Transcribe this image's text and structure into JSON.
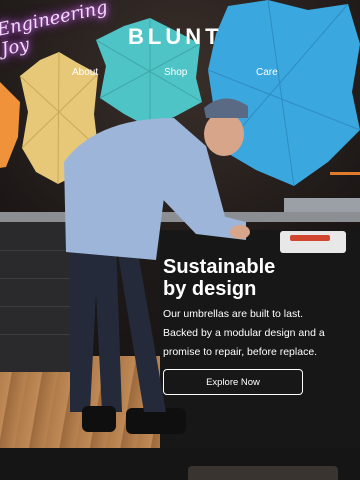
{
  "brand": {
    "logo_text": "BLUNT",
    "neon_sign": "Engineering Joy"
  },
  "nav": {
    "items": [
      {
        "label": "About"
      },
      {
        "label": "Shop"
      },
      {
        "label": "Care"
      }
    ]
  },
  "hero": {
    "headline_line1": "Sustainable",
    "headline_line2": "by design",
    "body_line1": "Our umbrellas are built to last.",
    "body_line2": "Backed by a modular design and a",
    "body_line3": "promise to repair, before replace.",
    "cta_label": "Explore Now"
  },
  "colors": {
    "umbrella_orange": "#f0923a",
    "umbrella_yellow": "#e6c878",
    "umbrella_teal": "#4fc4c6",
    "umbrella_blue": "#3aa7df",
    "neon_pink": "#f6d9ff",
    "shirt_blue": "#9db5d8"
  }
}
